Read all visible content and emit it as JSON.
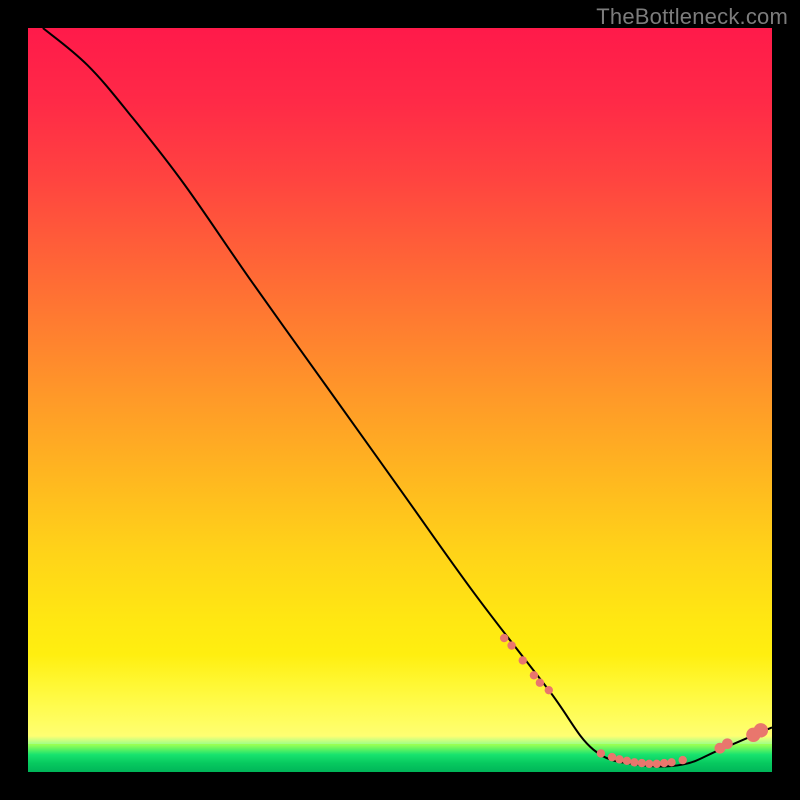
{
  "watermark": "TheBottleneck.com",
  "chart_data": {
    "type": "line",
    "title": "",
    "xlabel": "",
    "ylabel": "",
    "ylim": [
      0,
      100
    ],
    "xlim": [
      0,
      100
    ],
    "curve": [
      {
        "x": 2,
        "y": 100
      },
      {
        "x": 8,
        "y": 95
      },
      {
        "x": 14,
        "y": 88
      },
      {
        "x": 21,
        "y": 79
      },
      {
        "x": 30,
        "y": 66
      },
      {
        "x": 40,
        "y": 52
      },
      {
        "x": 50,
        "y": 38
      },
      {
        "x": 60,
        "y": 24
      },
      {
        "x": 70,
        "y": 11
      },
      {
        "x": 76,
        "y": 3
      },
      {
        "x": 82,
        "y": 1
      },
      {
        "x": 88,
        "y": 1
      },
      {
        "x": 93,
        "y": 3
      },
      {
        "x": 100,
        "y": 6
      }
    ],
    "markers_small": [
      {
        "x": 64,
        "y": 18
      },
      {
        "x": 65,
        "y": 17
      },
      {
        "x": 66.5,
        "y": 15
      },
      {
        "x": 68,
        "y": 13
      },
      {
        "x": 68.8,
        "y": 12
      },
      {
        "x": 70,
        "y": 11
      },
      {
        "x": 77,
        "y": 2.5
      },
      {
        "x": 78.5,
        "y": 2
      },
      {
        "x": 79.5,
        "y": 1.7
      },
      {
        "x": 80.5,
        "y": 1.5
      },
      {
        "x": 81.5,
        "y": 1.3
      },
      {
        "x": 82.5,
        "y": 1.2
      },
      {
        "x": 83.5,
        "y": 1.1
      },
      {
        "x": 84.5,
        "y": 1.1
      },
      {
        "x": 85.5,
        "y": 1.2
      },
      {
        "x": 86.5,
        "y": 1.3
      },
      {
        "x": 88,
        "y": 1.6
      }
    ],
    "markers_medium": [
      {
        "x": 93,
        "y": 3.2
      },
      {
        "x": 94,
        "y": 3.8
      }
    ],
    "markers_large": [
      {
        "x": 97.5,
        "y": 5.0
      },
      {
        "x": 98.5,
        "y": 5.6
      }
    ],
    "background_gradient": {
      "top": "#ff1a4a",
      "mid": "#ffd219",
      "bottom": "#00b559"
    },
    "curve_color": "#000000",
    "marker_color": "#e9766d"
  }
}
